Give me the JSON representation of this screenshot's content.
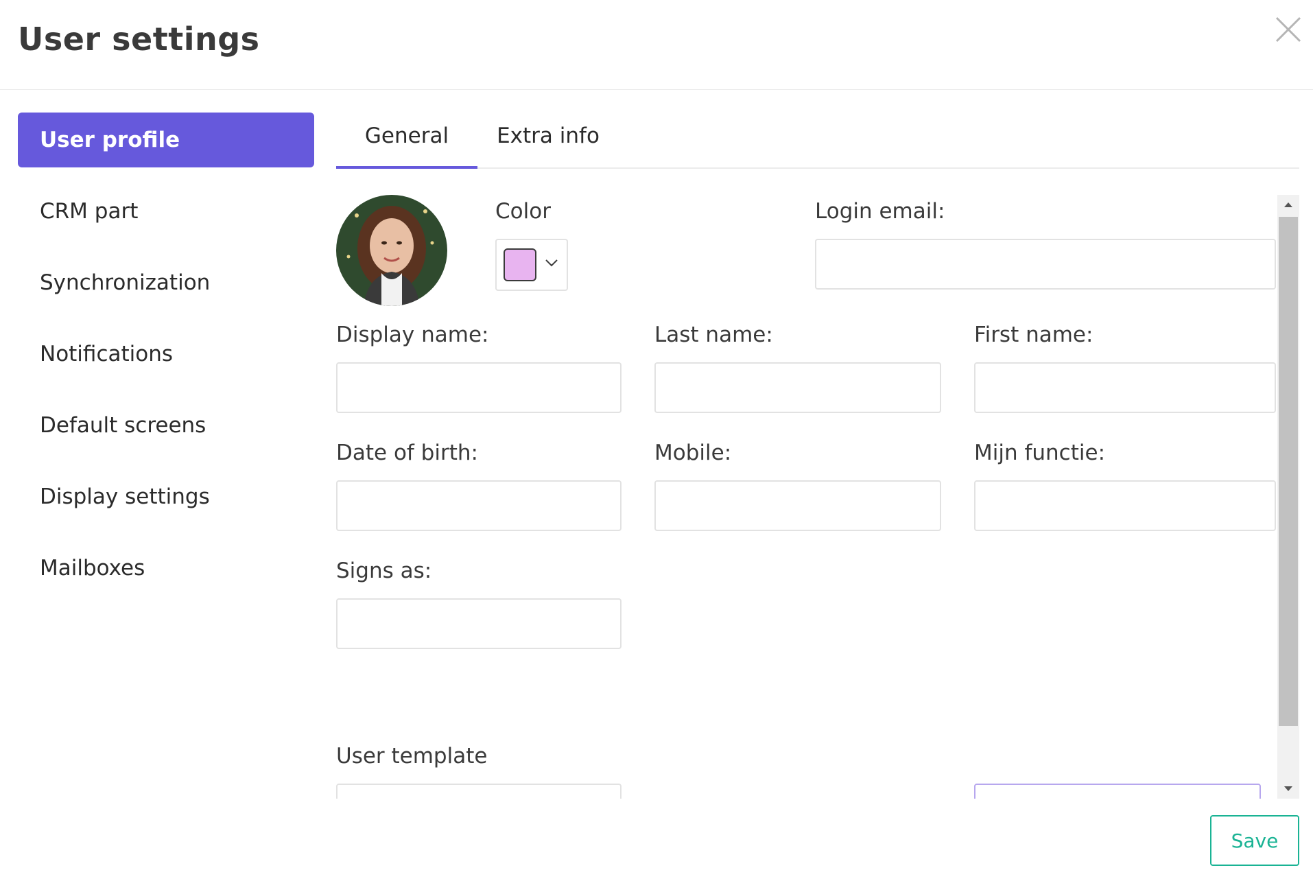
{
  "window": {
    "title": "User settings"
  },
  "sidebar": {
    "items": [
      {
        "label": "User profile",
        "active": true
      },
      {
        "label": "CRM part",
        "active": false
      },
      {
        "label": "Synchronization",
        "active": false
      },
      {
        "label": "Notifications",
        "active": false
      },
      {
        "label": "Default screens",
        "active": false
      },
      {
        "label": "Display settings",
        "active": false
      },
      {
        "label": "Mailboxes",
        "active": false
      }
    ]
  },
  "tabs": [
    {
      "label": "General",
      "active": true
    },
    {
      "label": "Extra info",
      "active": false
    }
  ],
  "form": {
    "color_label": "Color",
    "color_value": "#e8b4f0",
    "login_email_label": "Login email:",
    "login_email_value": "",
    "display_name_label": "Display name:",
    "display_name_value": "",
    "last_name_label": "Last name:",
    "last_name_value": "",
    "first_name_label": "First name:",
    "first_name_value": "",
    "date_of_birth_label": "Date of birth:",
    "date_of_birth_value": "",
    "mobile_label": "Mobile:",
    "mobile_value": "",
    "mijn_functie_label": "Mijn functie:",
    "mijn_functie_value": "",
    "signs_as_label": "Signs as:",
    "signs_as_value": "",
    "user_template_label": "User template"
  },
  "footer": {
    "save_label": "Save"
  },
  "colors": {
    "accent": "#6659dc",
    "save": "#1ab394",
    "field_border": "#e2e2e2"
  },
  "icons": {
    "close": "close-icon",
    "chevron": "chevron-down-icon",
    "scroll_up": "triangle-up-icon",
    "scroll_down": "triangle-down-icon"
  }
}
